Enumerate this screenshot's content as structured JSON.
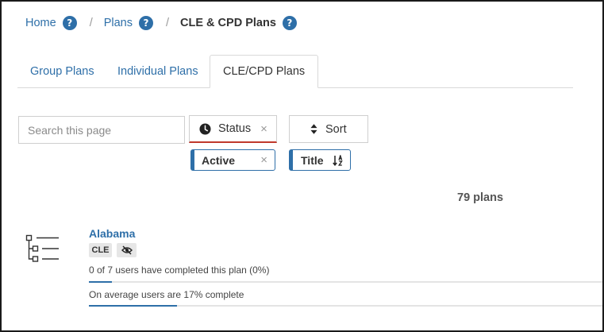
{
  "breadcrumb": {
    "home": "Home",
    "plans": "Plans",
    "current": "CLE & CPD Plans",
    "help_glyph": "?",
    "separator": "/"
  },
  "tabs": [
    {
      "label": "Group Plans",
      "active": false
    },
    {
      "label": "Individual Plans",
      "active": false
    },
    {
      "label": "CLE/CPD Plans",
      "active": true
    }
  ],
  "search": {
    "placeholder": "Search this page",
    "value": ""
  },
  "filters": {
    "status": {
      "label": "Status",
      "clear": "×",
      "icon": "clock-icon"
    },
    "sort": {
      "label": "Sort",
      "icon": "sort-arrows-icon"
    }
  },
  "chips": {
    "status_value": {
      "label": "Active",
      "clear": "×"
    },
    "sort_value": {
      "label": "Title",
      "icon": "sort-alpha-desc-icon"
    }
  },
  "count_label": "79 plans",
  "plans": [
    {
      "title": "Alabama",
      "badges": [
        {
          "label": "CLE"
        },
        {
          "icon": "eye-slash-icon"
        }
      ],
      "completion_text": "0 of 7 users have completed this plan (0%)",
      "completion_fraction": 0.045,
      "average_text": "On average users are 17% complete",
      "average_fraction": 0.17
    }
  ],
  "colors": {
    "link": "#2e6fa8",
    "accent_red": "#c0392b",
    "border": "#cfcfcf",
    "badge_bg": "#e6e6e6"
  }
}
